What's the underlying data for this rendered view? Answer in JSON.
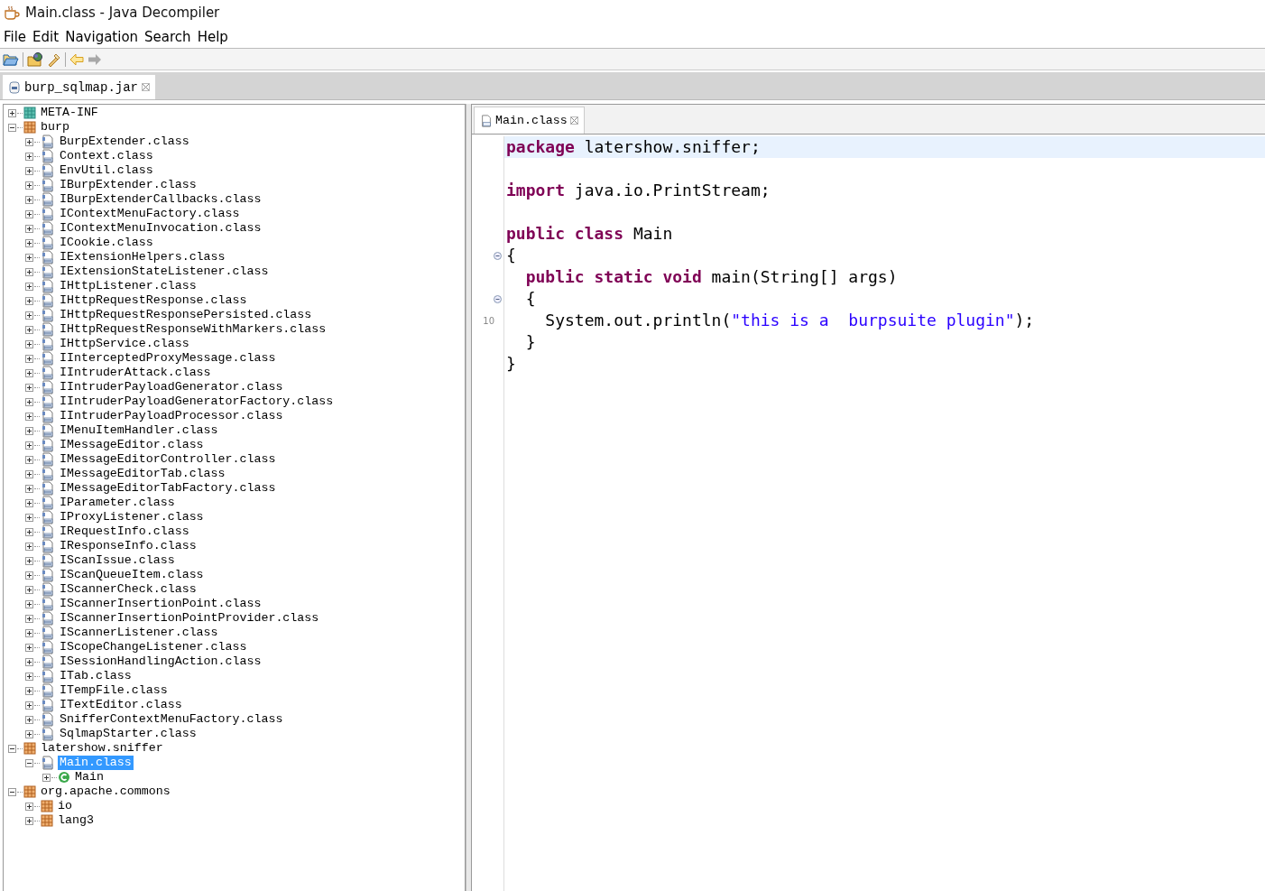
{
  "window": {
    "title": "Main.class - Java Decompiler"
  },
  "menu": [
    "File",
    "Edit",
    "Navigation",
    "Search",
    "Help"
  ],
  "file_tabs": [
    {
      "label": "burp_sqlmap.jar",
      "selected": true
    }
  ],
  "tree": [
    {
      "label": "META-INF",
      "kind": "folder",
      "expanded": false,
      "selected": false
    },
    {
      "label": "burp",
      "kind": "package",
      "expanded": true,
      "selected": false,
      "children": [
        {
          "label": "BurpExtender.class",
          "kind": "class",
          "expanded": false,
          "selected": false
        },
        {
          "label": "Context.class",
          "kind": "class",
          "expanded": false,
          "selected": false
        },
        {
          "label": "EnvUtil.class",
          "kind": "class",
          "expanded": false,
          "selected": false
        },
        {
          "label": "IBurpExtender.class",
          "kind": "class",
          "expanded": false,
          "selected": false
        },
        {
          "label": "IBurpExtenderCallbacks.class",
          "kind": "class",
          "expanded": false,
          "selected": false
        },
        {
          "label": "IContextMenuFactory.class",
          "kind": "class",
          "expanded": false,
          "selected": false
        },
        {
          "label": "IContextMenuInvocation.class",
          "kind": "class",
          "expanded": false,
          "selected": false
        },
        {
          "label": "ICookie.class",
          "kind": "class",
          "expanded": false,
          "selected": false
        },
        {
          "label": "IExtensionHelpers.class",
          "kind": "class",
          "expanded": false,
          "selected": false
        },
        {
          "label": "IExtensionStateListener.class",
          "kind": "class",
          "expanded": false,
          "selected": false
        },
        {
          "label": "IHttpListener.class",
          "kind": "class",
          "expanded": false,
          "selected": false
        },
        {
          "label": "IHttpRequestResponse.class",
          "kind": "class",
          "expanded": false,
          "selected": false
        },
        {
          "label": "IHttpRequestResponsePersisted.class",
          "kind": "class",
          "expanded": false,
          "selected": false
        },
        {
          "label": "IHttpRequestResponseWithMarkers.class",
          "kind": "class",
          "expanded": false,
          "selected": false
        },
        {
          "label": "IHttpService.class",
          "kind": "class",
          "expanded": false,
          "selected": false
        },
        {
          "label": "IInterceptedProxyMessage.class",
          "kind": "class",
          "expanded": false,
          "selected": false
        },
        {
          "label": "IIntruderAttack.class",
          "kind": "class",
          "expanded": false,
          "selected": false
        },
        {
          "label": "IIntruderPayloadGenerator.class",
          "kind": "class",
          "expanded": false,
          "selected": false
        },
        {
          "label": "IIntruderPayloadGeneratorFactory.class",
          "kind": "class",
          "expanded": false,
          "selected": false
        },
        {
          "label": "IIntruderPayloadProcessor.class",
          "kind": "class",
          "expanded": false,
          "selected": false
        },
        {
          "label": "IMenuItemHandler.class",
          "kind": "class",
          "expanded": false,
          "selected": false
        },
        {
          "label": "IMessageEditor.class",
          "kind": "class",
          "expanded": false,
          "selected": false
        },
        {
          "label": "IMessageEditorController.class",
          "kind": "class",
          "expanded": false,
          "selected": false
        },
        {
          "label": "IMessageEditorTab.class",
          "kind": "class",
          "expanded": false,
          "selected": false
        },
        {
          "label": "IMessageEditorTabFactory.class",
          "kind": "class",
          "expanded": false,
          "selected": false
        },
        {
          "label": "IParameter.class",
          "kind": "class",
          "expanded": false,
          "selected": false
        },
        {
          "label": "IProxyListener.class",
          "kind": "class",
          "expanded": false,
          "selected": false
        },
        {
          "label": "IRequestInfo.class",
          "kind": "class",
          "expanded": false,
          "selected": false
        },
        {
          "label": "IResponseInfo.class",
          "kind": "class",
          "expanded": false,
          "selected": false
        },
        {
          "label": "IScanIssue.class",
          "kind": "class",
          "expanded": false,
          "selected": false
        },
        {
          "label": "IScanQueueItem.class",
          "kind": "class",
          "expanded": false,
          "selected": false
        },
        {
          "label": "IScannerCheck.class",
          "kind": "class",
          "expanded": false,
          "selected": false
        },
        {
          "label": "IScannerInsertionPoint.class",
          "kind": "class",
          "expanded": false,
          "selected": false
        },
        {
          "label": "IScannerInsertionPointProvider.class",
          "kind": "class",
          "expanded": false,
          "selected": false
        },
        {
          "label": "IScannerListener.class",
          "kind": "class",
          "expanded": false,
          "selected": false
        },
        {
          "label": "IScopeChangeListener.class",
          "kind": "class",
          "expanded": false,
          "selected": false
        },
        {
          "label": "ISessionHandlingAction.class",
          "kind": "class",
          "expanded": false,
          "selected": false
        },
        {
          "label": "ITab.class",
          "kind": "class",
          "expanded": false,
          "selected": false
        },
        {
          "label": "ITempFile.class",
          "kind": "class",
          "expanded": false,
          "selected": false
        },
        {
          "label": "ITextEditor.class",
          "kind": "class",
          "expanded": false,
          "selected": false
        },
        {
          "label": "SnifferContextMenuFactory.class",
          "kind": "class",
          "expanded": false,
          "selected": false
        },
        {
          "label": "SqlmapStarter.class",
          "kind": "class",
          "expanded": false,
          "selected": false
        }
      ]
    },
    {
      "label": "latershow.sniffer",
      "kind": "package",
      "expanded": true,
      "selected": false,
      "children": [
        {
          "label": "Main.class",
          "kind": "class",
          "expanded": true,
          "selected": true,
          "children": [
            {
              "label": "Main",
              "kind": "type",
              "expanded": false,
              "selected": false
            }
          ]
        }
      ]
    },
    {
      "label": "org.apache.commons",
      "kind": "package",
      "expanded": true,
      "selected": false,
      "children": [
        {
          "label": "io",
          "kind": "package",
          "expanded": false,
          "selected": false
        },
        {
          "label": "lang3",
          "kind": "package",
          "expanded": false,
          "selected": false
        }
      ]
    }
  ],
  "editor_tabs": [
    {
      "label": "Main.class",
      "selected": true
    }
  ],
  "code": [
    {
      "kind": "code",
      "current": true,
      "foldable": false,
      "tokens": [
        {
          "kind": "keyword",
          "text": "package"
        },
        {
          "kind": "plain",
          "text": " latershow.sniffer;"
        }
      ]
    },
    {
      "kind": "blank",
      "current": false,
      "foldable": false
    },
    {
      "kind": "code",
      "current": false,
      "foldable": false,
      "tokens": [
        {
          "kind": "keyword",
          "text": "import"
        },
        {
          "kind": "plain",
          "text": " java.io.PrintStream;"
        }
      ]
    },
    {
      "kind": "blank",
      "current": false,
      "foldable": false
    },
    {
      "kind": "code",
      "current": false,
      "foldable": false,
      "tokens": [
        {
          "kind": "keyword",
          "text": "public class"
        },
        {
          "kind": "plain",
          "text": " Main"
        }
      ]
    },
    {
      "kind": "code",
      "current": false,
      "foldable": true,
      "tokens": [
        {
          "kind": "plain",
          "text": "{"
        }
      ]
    },
    {
      "kind": "code",
      "current": false,
      "foldable": false,
      "tokens": [
        {
          "kind": "keyword",
          "text": "  public static void"
        },
        {
          "kind": "plain",
          "text": " main(String[] args)"
        }
      ]
    },
    {
      "kind": "code",
      "current": false,
      "foldable": true,
      "tokens": [
        {
          "kind": "plain",
          "text": "  {"
        }
      ]
    },
    {
      "kind": "code",
      "current": false,
      "foldable": false,
      "number": "10",
      "tokens": [
        {
          "kind": "plain",
          "text": "    System.out.println("
        },
        {
          "kind": "string",
          "text": "\"this is a  burpsuite plugin\""
        },
        {
          "kind": "plain",
          "text": ");"
        }
      ]
    },
    {
      "kind": "code",
      "current": false,
      "foldable": false,
      "tokens": [
        {
          "kind": "plain",
          "text": "  }"
        }
      ]
    },
    {
      "kind": "code",
      "current": false,
      "foldable": false,
      "tokens": [
        {
          "kind": "plain",
          "text": "}"
        }
      ]
    }
  ]
}
